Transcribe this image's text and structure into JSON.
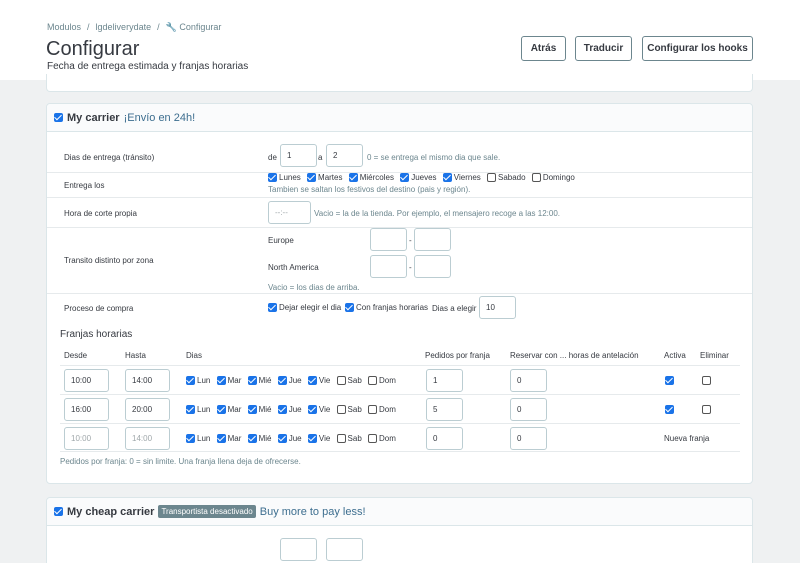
{
  "breadcrumb": [
    "Modulos",
    "lgdeliverydate",
    "Configurar"
  ],
  "page": {
    "title": "Configurar",
    "subtitle": "Fecha de entrega estimada y franjas horarias"
  },
  "toolbar": {
    "back": "Atrás",
    "translate": "Traducir",
    "hooks": "Configurar los hooks"
  },
  "carrier1": {
    "name": "My carrier",
    "tagline": "¡Envío en 24h!",
    "enabled": true,
    "transit_label": "Dias de entrega (tránsito)",
    "transit_de": "de",
    "transit_min": "1",
    "transit_a": "a",
    "transit_max": "2",
    "transit_help": "0 = se entrega el mismo dia que sale.",
    "deliver_label": "Entrega los",
    "days": [
      {
        "name": "Lunes",
        "checked": true
      },
      {
        "name": "Martes",
        "checked": true
      },
      {
        "name": "Miércoles",
        "checked": true
      },
      {
        "name": "Jueves",
        "checked": true
      },
      {
        "name": "Viernes",
        "checked": true
      },
      {
        "name": "Sabado",
        "checked": false
      },
      {
        "name": "Domingo",
        "checked": false
      }
    ],
    "deliver_help": "Tambien se saltan los festivos del destino (pais y región).",
    "cutoff_label": "Hora de corte propia",
    "cutoff_placeholder": "--:--",
    "cutoff_help": "Vacio = la de la tienda. Por ejemplo, el mensajero recoge a las 12:00.",
    "zone_label": "Transito distinto por zona",
    "zones": [
      "Europe",
      "North America"
    ],
    "zone_help": "Vacio = los dias de arriba.",
    "checkout_label": "Proceso de compra",
    "let_choose": "Dejar elegir el dia",
    "with_slots": "Con franjas horarias",
    "days_to_choose_label": "Dias a elegir",
    "days_to_choose": "10",
    "slots_title": "Franjas horarias",
    "slots_headers": {
      "from": "Desde",
      "to": "Hasta",
      "days": "Dias",
      "orders": "Pedidos por franja",
      "reserve": "Reservar con ... horas de antelación",
      "active": "Activa",
      "delete": "Eliminar"
    },
    "short_days": [
      "Lun",
      "Mar",
      "Mié",
      "Jue",
      "Vie",
      "Sab",
      "Dom"
    ],
    "slots": [
      {
        "from": "10:00",
        "to": "14:00",
        "orders": "1",
        "reserve": "0",
        "active": true
      },
      {
        "from": "16:00",
        "to": "20:00",
        "orders": "5",
        "reserve": "0",
        "active": true
      }
    ],
    "new_slot": {
      "from": "10:00",
      "to": "14:00",
      "orders": "0",
      "reserve": "0",
      "label": "Nueva franja"
    },
    "slots_help": "Pedidos por franja: 0 = sin limite. Una franja llena deja de ofrecerse."
  },
  "carrier2": {
    "name": "My cheap carrier",
    "badge": "Transportista desactivado",
    "tagline": "Buy more to pay less!",
    "enabled": true
  },
  "colors": {
    "accent": "#1a73e8",
    "tagline": "#3d6e8f",
    "border": "#dbe6e9"
  }
}
